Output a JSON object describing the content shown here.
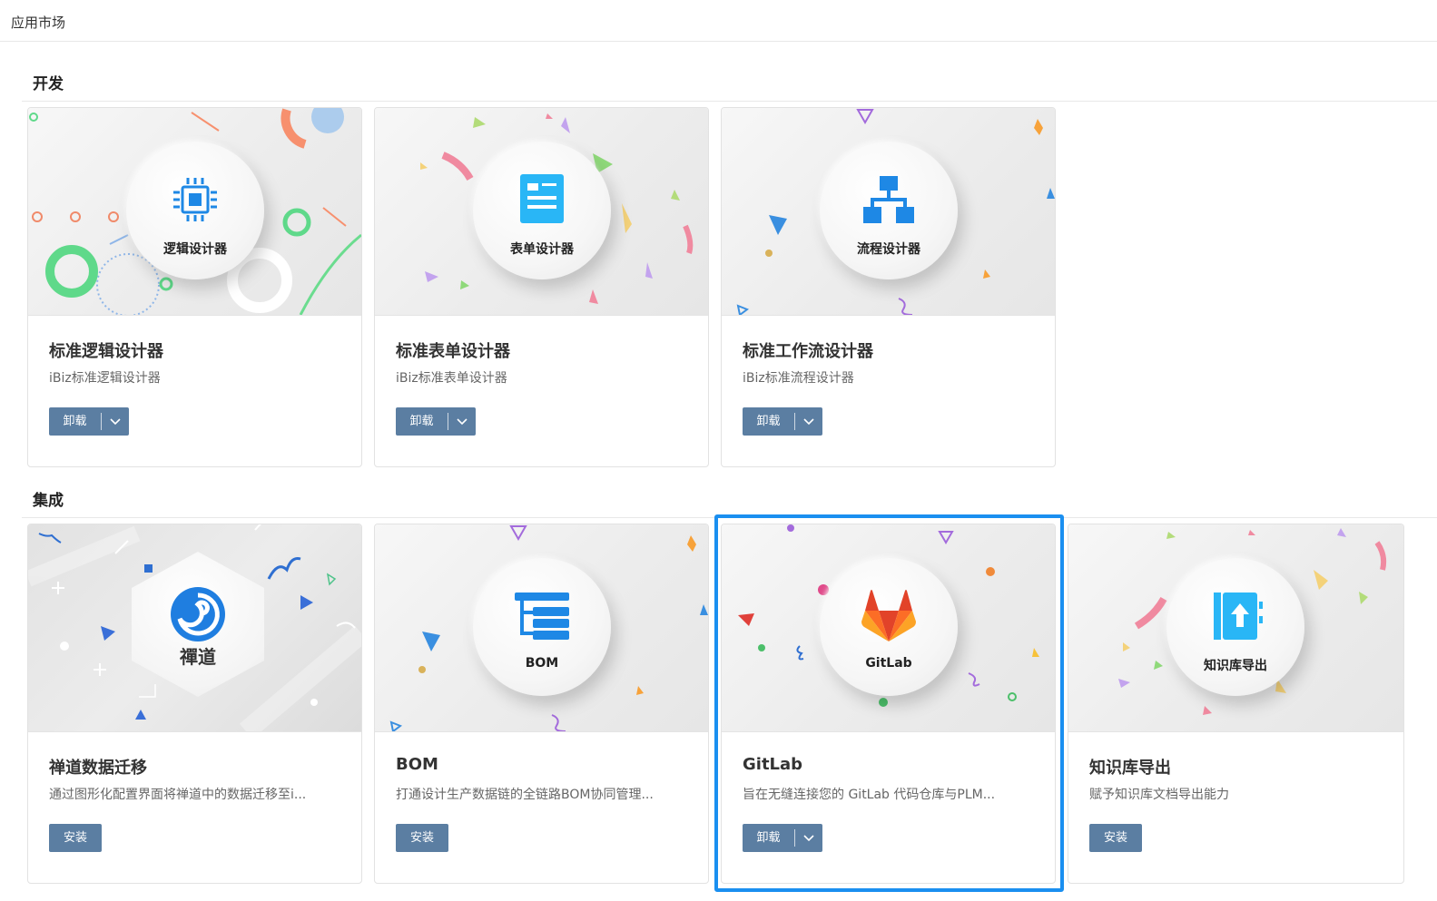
{
  "app": {
    "title": "应用市场"
  },
  "sections": [
    {
      "title": "开发",
      "cards": [
        {
          "medal_label": "逻辑设计器",
          "icon": "cpu-chip-icon",
          "name": "标准逻辑设计器",
          "desc": "iBiz标准逻辑设计器",
          "action": "卸载",
          "has_dropdown": true
        },
        {
          "medal_label": "表单设计器",
          "icon": "form-document-icon",
          "name": "标准表单设计器",
          "desc": "iBiz标准表单设计器",
          "action": "卸载",
          "has_dropdown": true
        },
        {
          "medal_label": "流程设计器",
          "icon": "org-chart-icon",
          "name": "标准工作流设计器",
          "desc": "iBiz标准流程设计器",
          "action": "卸载",
          "has_dropdown": true
        }
      ]
    },
    {
      "title": "集成",
      "cards": [
        {
          "medal_label": "禪道",
          "icon": "zentao-logo-icon",
          "name": "禅道数据迁移",
          "desc": "通过图形化配置界面将禅道中的数据迁移至i...",
          "action": "安装",
          "has_dropdown": false
        },
        {
          "medal_label": "BOM",
          "icon": "bom-tree-icon",
          "name": "BOM",
          "desc": "打通设计生产数据链的全链路BOM协同管理...",
          "action": "安装",
          "has_dropdown": false
        },
        {
          "medal_label": "GitLab",
          "icon": "gitlab-fox-icon",
          "name": "GitLab",
          "desc": "旨在无缝连接您的 GitLab 代码仓库与PLM...",
          "action": "卸载",
          "has_dropdown": true,
          "selected": true
        },
        {
          "medal_label": "知识库导出",
          "icon": "knowledge-export-icon",
          "name": "知识库导出",
          "desc": "赋予知识库文档导出能力",
          "action": "安装",
          "has_dropdown": false
        }
      ]
    }
  ],
  "colors": {
    "button": "#5b7ea2",
    "selection": "#1a8ff0",
    "icon_blue": "#1e88e5"
  }
}
